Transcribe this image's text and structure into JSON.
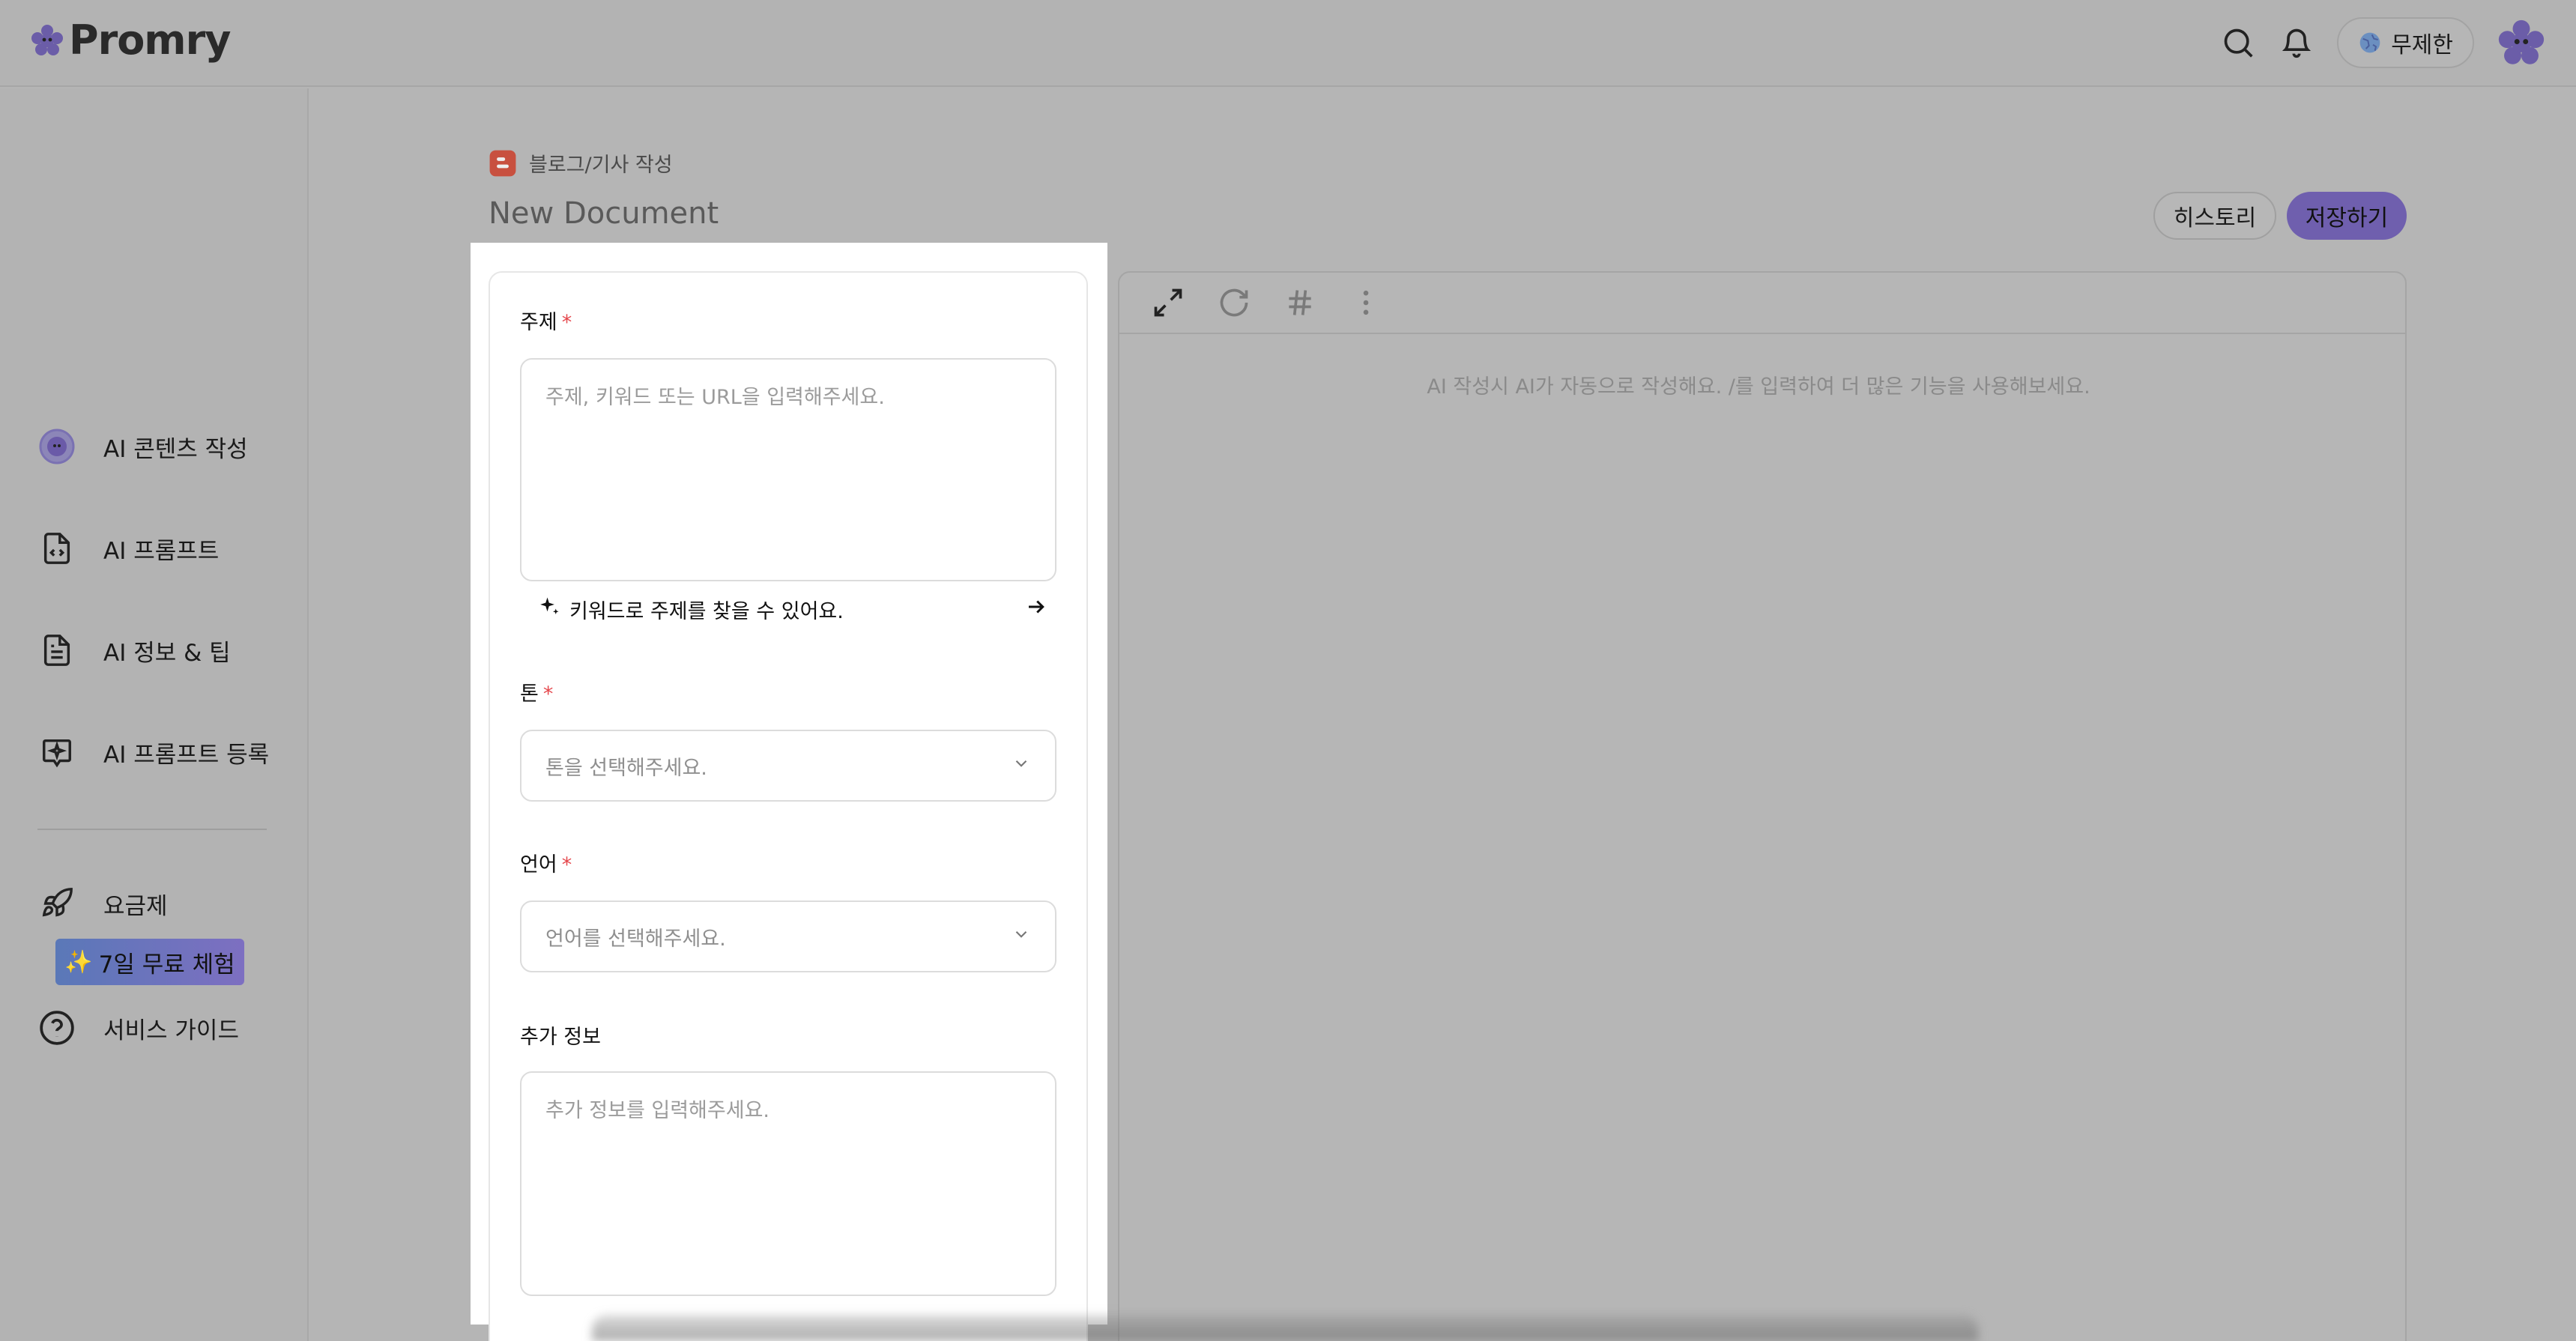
{
  "app": {
    "brand": "Promry",
    "colors": {
      "accent": "#7b6bd6",
      "required": "#e5484d",
      "overlay": "#b3b3b3"
    }
  },
  "header": {
    "plan_label": "무제한",
    "icons": [
      "search-icon",
      "bell-icon",
      "globe-icon",
      "avatar-icon"
    ]
  },
  "sidebar": {
    "items": [
      {
        "label": "AI 콘텐츠 작성",
        "icon": "ai-content-icon"
      },
      {
        "label": "AI 프롬프트",
        "icon": "code-file-icon"
      },
      {
        "label": "AI 정보 & 팁",
        "icon": "document-icon"
      },
      {
        "label": "AI 프롬프트 등록",
        "icon": "sparkle-chat-icon"
      }
    ],
    "pricing_label": "요금제",
    "trial_label": "7일 무료 체험",
    "guide_label": "서비스 가이드"
  },
  "page": {
    "breadcrumb": "블로그/기사 작성",
    "doc_title": "New Document",
    "history_label": "히스토리",
    "save_label": "저장하기"
  },
  "form": {
    "topic": {
      "label": "주제",
      "required_mark": "*",
      "placeholder": "주제, 키워드 또는 URL을 입력해주세요."
    },
    "keyword_suggest": "키워드로 주제를 찾을 수 있어요.",
    "tone": {
      "label": "톤",
      "required_mark": "*",
      "placeholder": "톤을 선택해주세요."
    },
    "language": {
      "label": "언어",
      "required_mark": "*",
      "placeholder": "언어를 선택해주세요."
    },
    "extra": {
      "label": "추가 정보",
      "placeholder": "추가 정보를 입력해주세요."
    }
  },
  "editor": {
    "placeholder": "AI 작성시 AI가 자동으로 작성해요. /를 입력하여 더 많은 기능을 사용해보세요.",
    "toolbar": [
      "expand-icon",
      "refresh-icon",
      "hash-icon",
      "more-vertical-icon"
    ]
  }
}
